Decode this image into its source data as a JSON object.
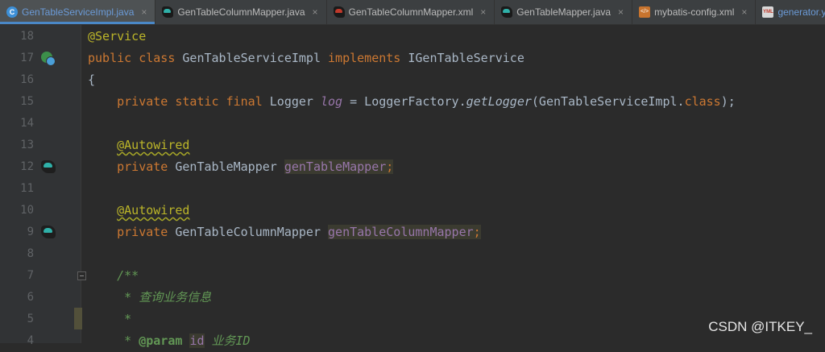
{
  "tabs": [
    {
      "label": "GenTableServiceImpl.java",
      "icon": "java-class-icon",
      "active": true
    },
    {
      "label": "GenTableColumnMapper.java",
      "icon": "mybatis-bird-icon"
    },
    {
      "label": "GenTableColumnMapper.xml",
      "icon": "mybatis-bird-red-icon"
    },
    {
      "label": "GenTableMapper.java",
      "icon": "mybatis-bird-icon"
    },
    {
      "label": "mybatis-config.xml",
      "icon": "xml-file-icon"
    },
    {
      "label": "generator.yml",
      "icon": "yml-file-icon"
    }
  ],
  "tab_close": "×",
  "icon_text": {
    "class": "C",
    "xml": "</>",
    "yml": "YML"
  },
  "editor": {
    "lines": [
      {
        "num": "18",
        "parts": [
          [
            "ann",
            "@Service"
          ]
        ]
      },
      {
        "num": "17",
        "gutter_icon": "implements-interface-icon",
        "parts": [
          [
            "kw",
            "public class "
          ],
          [
            "p",
            "GenTableServiceImpl "
          ],
          [
            "kw",
            "implements "
          ],
          [
            "p",
            "IGenTableService"
          ]
        ]
      },
      {
        "num": "16",
        "parts": [
          [
            "p",
            "{"
          ]
        ]
      },
      {
        "num": "15",
        "parts": [
          [
            "p",
            "    "
          ],
          [
            "kw",
            "private static final "
          ],
          [
            "p",
            "Logger "
          ],
          [
            "static",
            "log"
          ],
          [
            "p",
            " = LoggerFactory."
          ],
          [
            "method",
            "getLogger"
          ],
          [
            "p",
            "(GenTableServiceImpl."
          ],
          [
            "kw",
            "class"
          ],
          [
            "p",
            ");"
          ]
        ]
      },
      {
        "num": "14",
        "parts": []
      },
      {
        "num": "13",
        "parts": [
          [
            "p",
            "    "
          ],
          [
            "annw",
            "@Autowired"
          ]
        ]
      },
      {
        "num": "12",
        "gutter_icon": "mybatis-navigate-icon",
        "parts": [
          [
            "p",
            "    "
          ],
          [
            "kw",
            "private "
          ],
          [
            "p",
            "GenTableMapper "
          ],
          [
            "fieldhl",
            "genTableMapper"
          ],
          [
            "kwhl",
            ";"
          ]
        ]
      },
      {
        "num": "11",
        "parts": []
      },
      {
        "num": "10",
        "parts": [
          [
            "p",
            "    "
          ],
          [
            "annw",
            "@Autowired"
          ]
        ]
      },
      {
        "num": "9",
        "gutter_icon": "mybatis-navigate-icon",
        "parts": [
          [
            "p",
            "    "
          ],
          [
            "kw",
            "private "
          ],
          [
            "p",
            "GenTableColumnMapper "
          ],
          [
            "fieldhl",
            "genTableColumnMapper"
          ],
          [
            "kwhl",
            ";"
          ]
        ]
      },
      {
        "num": "8",
        "parts": []
      },
      {
        "num": "7",
        "fold": true,
        "parts": [
          [
            "p",
            "    "
          ],
          [
            "doc",
            "/**"
          ]
        ]
      },
      {
        "num": "6",
        "parts": [
          [
            "p",
            "     "
          ],
          [
            "doc",
            "* 查询业务信息"
          ]
        ]
      },
      {
        "num": "5",
        "parts": [
          [
            "p",
            "     "
          ],
          [
            "doc",
            "*"
          ]
        ]
      },
      {
        "num": "4",
        "parts": [
          [
            "p",
            "     "
          ],
          [
            "doc",
            "* "
          ],
          [
            "doctag",
            "@param"
          ],
          [
            "p",
            " "
          ],
          [
            "docfield",
            "id"
          ],
          [
            "doc",
            " 业务ID"
          ]
        ]
      }
    ]
  },
  "watermark": "CSDN @ITKEY_",
  "colors": {
    "background": "#2b2b2b",
    "keyword": "#cc7832",
    "annotation": "#bbb529",
    "field": "#9876aa",
    "doc": "#629755"
  }
}
